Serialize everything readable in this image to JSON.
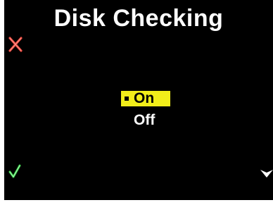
{
  "screen": {
    "title": "Disk Checking"
  },
  "menu": {
    "options": [
      {
        "label": "On",
        "selected": true
      },
      {
        "label": "Off",
        "selected": false
      }
    ]
  },
  "icons": {
    "cancel": "close-x-icon",
    "confirm": "checkmark-icon",
    "down": "chevron-down-icon"
  },
  "colors": {
    "background": "#000000",
    "highlight": "#f2ee1a",
    "cancel": "#e8443a",
    "confirm": "#3bd14a",
    "text": "#ffffff"
  }
}
